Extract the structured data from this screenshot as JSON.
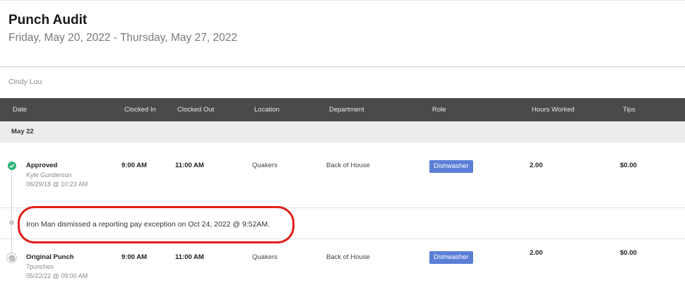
{
  "header": {
    "title": "Punch Audit",
    "date_range": "Friday, May 20, 2022 - Thursday, May 27, 2022"
  },
  "employee_name": "Cindy Lou",
  "columns": {
    "date": "Date",
    "clocked_in": "Clocked In",
    "clocked_out": "Clocked Out",
    "location": "Location",
    "department": "Department",
    "role": "Role",
    "hours_worked": "Hours Worked",
    "tips": "Tips"
  },
  "date_group": "May 22",
  "entries": [
    {
      "status": "Approved",
      "actor": "Kyle Gunderson",
      "timestamp": "06/29/18 @ 10:23 AM",
      "clocked_in": "9:00 AM",
      "clocked_out": "11:00 AM",
      "location": "Quakers",
      "department": "Back of House",
      "role": "Dishwasher",
      "hours_worked": "2.00",
      "tips": "$0.00",
      "icon": "check-circle-icon",
      "icon_color": "#2db37a"
    },
    {
      "status": "Original Punch",
      "actor": "7punches",
      "timestamp": "05/22/22 @ 09:00 AM",
      "clocked_in": "9:00 AM",
      "clocked_out": "11:00 AM",
      "location": "Quakers",
      "department": "Back of House",
      "role": "Dishwasher",
      "hours_worked": "2.00",
      "tips": "$0.00",
      "icon": "clock-icon",
      "icon_color": "#d6d6d6"
    }
  ],
  "exception_note": "Iron Man dismissed a reporting pay exception on Oct 24, 2022 @ 9:52AM.",
  "colors": {
    "table_header_bg": "#4a4a4a",
    "role_badge": "#5b7fd6",
    "highlight": "#e0201a"
  }
}
